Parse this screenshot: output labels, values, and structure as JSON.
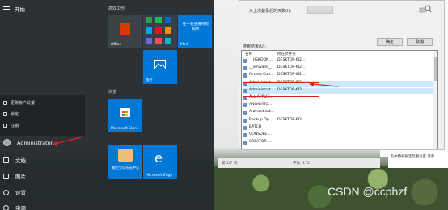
{
  "start": {
    "title": "开始",
    "popup": [
      {
        "label": "更改帐户设置"
      },
      {
        "label": "锁定"
      },
      {
        "label": "注销"
      }
    ],
    "user": "Administrator",
    "left_items": [
      {
        "label": "文档"
      },
      {
        "label": "图片"
      },
      {
        "label": "设置"
      },
      {
        "label": "电源"
      }
    ],
    "groups": {
      "productivity": "高效工作",
      "browse": "浏览"
    },
    "tiles": {
      "office": "Office",
      "mail_text": "在一处查看所有邮件",
      "mail": "Mail",
      "photos": "图片",
      "store": "Microsoft Store",
      "game_text": "我的宝贝乐园中心",
      "edge": "Microsoft Edge"
    }
  },
  "dialog": {
    "top_label": "从上次登录后的天数(I):",
    "find_btn": "立即查找(N)",
    "ok_btn": "确定",
    "cancel_btn": "取消",
    "results_label": "搜索结果(U):",
    "columns": {
      "name": "名称",
      "folder": "所在文件夹"
    },
    "rows": [
      {
        "name": "__HSKDDN...",
        "folder": "DESKTOP-6I2..."
      },
      {
        "name": "__vmware__",
        "folder": "DESKTOP-6I2..."
      },
      {
        "name": "Access Con...",
        "folder": "DESKTOP-6I2..."
      },
      {
        "name": "Administrat...",
        "folder": "DESKTOP-6I2..."
      },
      {
        "name": "Administrat...",
        "folder": "DESKTOP-6I2..."
      },
      {
        "name": "ALL APPLIC...",
        "folder": ""
      },
      {
        "name": "ANONYMO...",
        "folder": ""
      },
      {
        "name": "Authenticat...",
        "folder": ""
      },
      {
        "name": "Backup Op...",
        "folder": "DESKTOP-6I2..."
      },
      {
        "name": "BATCH",
        "folder": ""
      },
      {
        "name": "CONSOLE ...",
        "folder": ""
      },
      {
        "name": "CREATOR ...",
        "folder": ""
      }
    ]
  },
  "status": {
    "page_text": "第 1/7 页",
    "words": "字数: 172",
    "right_hint": "有关特权报告及重设置,请参..."
  },
  "watermark": "CSDN @ccphzf",
  "colors": {
    "accent_tile": "#0078d7",
    "office": "#d83b01",
    "store": "#0078d7",
    "annotation": "#e02020"
  }
}
